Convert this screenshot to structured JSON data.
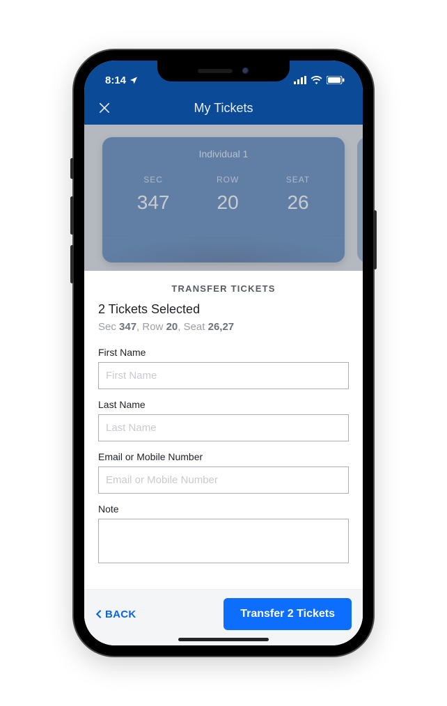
{
  "status": {
    "time": "8:14"
  },
  "nav": {
    "title": "My Tickets"
  },
  "ticket": {
    "label": "Individual 1",
    "sec_h": "SEC",
    "sec_v": "347",
    "row_h": "ROW",
    "row_v": "20",
    "seat_h": "SEAT",
    "seat_v": "26"
  },
  "sheet": {
    "title": "TRANSFER TICKETS",
    "count": "2 Tickets Selected",
    "loc_sec_l": "Sec ",
    "loc_sec_v": "347",
    "loc_row_l": ", Row ",
    "loc_row_v": "20",
    "loc_seat_l": ", Seat ",
    "loc_seat_v": "26,27"
  },
  "fields": {
    "first_label": "First Name",
    "first_ph": "First Name",
    "last_label": "Last Name",
    "last_ph": "Last Name",
    "email_label": "Email or Mobile Number",
    "email_ph": "Email or Mobile Number",
    "note_label": "Note"
  },
  "footer": {
    "back": "BACK",
    "primary": "Transfer 2 Tickets"
  }
}
